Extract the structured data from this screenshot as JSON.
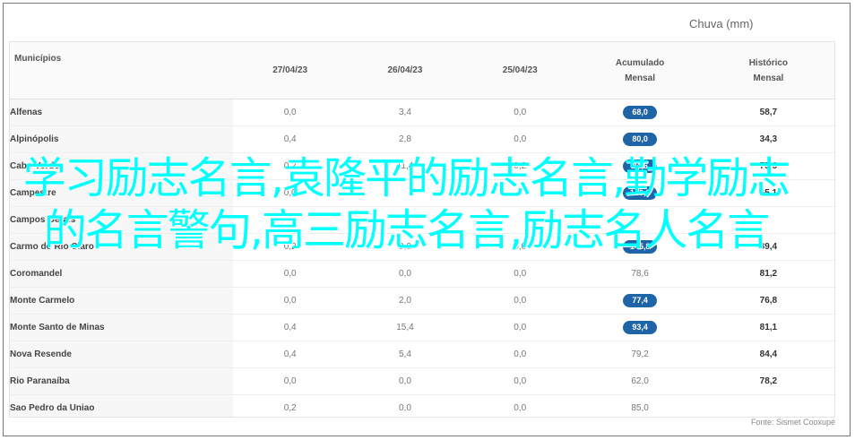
{
  "header": {
    "title": "Chuva (mm)"
  },
  "columns": {
    "municipio": "Municípios",
    "d1": "27/04/23",
    "d2": "26/04/23",
    "d3": "25/04/23",
    "acum_line1": "Acumulado",
    "acum_line2": "Mensal",
    "hist_line1": "Histórico",
    "hist_line2": "Mensal"
  },
  "rows": [
    {
      "name": "Alfenas",
      "d1": "0,0",
      "d2": "3,4",
      "d3": "0,0",
      "acum": "68,0",
      "badge": true,
      "hist": "58,7"
    },
    {
      "name": "Alpinópolis",
      "d1": "0,4",
      "d2": "2,8",
      "d3": "0,0",
      "acum": "80,0",
      "badge": true,
      "hist": "34,3"
    },
    {
      "name": "Cabo Verde",
      "d1": "0,2",
      "d2": "11,4",
      "d3": "0,2",
      "acum": "94,6",
      "badge": true,
      "hist": "75,6"
    },
    {
      "name": "Campestre",
      "d1": "0,0",
      "d2": "",
      "d3": "",
      "acum": "140,0",
      "badge": true,
      "hist": "65,1"
    },
    {
      "name": "Campos Gerais",
      "d1": "",
      "d2": "",
      "d3": "",
      "acum": "",
      "badge": true,
      "hist": ""
    },
    {
      "name": "Carmo do Rio Claro",
      "d1": "0,2",
      "d2": "9,2",
      "d3": "0,0",
      "acum": "145,8",
      "badge": true,
      "hist": "89,4"
    },
    {
      "name": "Coromandel",
      "d1": "0,0",
      "d2": "0,0",
      "d3": "0,0",
      "acum": "78,6",
      "badge": false,
      "hist": "81,2"
    },
    {
      "name": "Monte Carmelo",
      "d1": "0,0",
      "d2": "2,0",
      "d3": "0,0",
      "acum": "77,4",
      "badge": true,
      "hist": "76,8"
    },
    {
      "name": "Monte Santo de Minas",
      "d1": "0,4",
      "d2": "15,4",
      "d3": "0,0",
      "acum": "93,4",
      "badge": true,
      "hist": "81,1"
    },
    {
      "name": "Nova Resende",
      "d1": "0,4",
      "d2": "5,4",
      "d3": "0,0",
      "acum": "79,2",
      "badge": false,
      "hist": "84,4"
    },
    {
      "name": "Rio Paranaíba",
      "d1": "0,0",
      "d2": "0,0",
      "d3": "0,0",
      "acum": "62,0",
      "badge": false,
      "hist": "78,2"
    },
    {
      "name": "Sao Pedro da Uniao",
      "d1": "0,2",
      "d2": "0,0",
      "d3": "0,0",
      "acum": "85,0",
      "badge": false,
      "hist": ""
    }
  ],
  "footer": {
    "source": "Fonte: Sismet Cooxupé"
  },
  "overlay": {
    "text": "学习励志名言,袁隆平的励志名言,勤学励志的名言警句,高三励志名言,励志名人名言"
  },
  "colors": {
    "badge": "#1f64a6",
    "overlay": "#00ffff"
  }
}
